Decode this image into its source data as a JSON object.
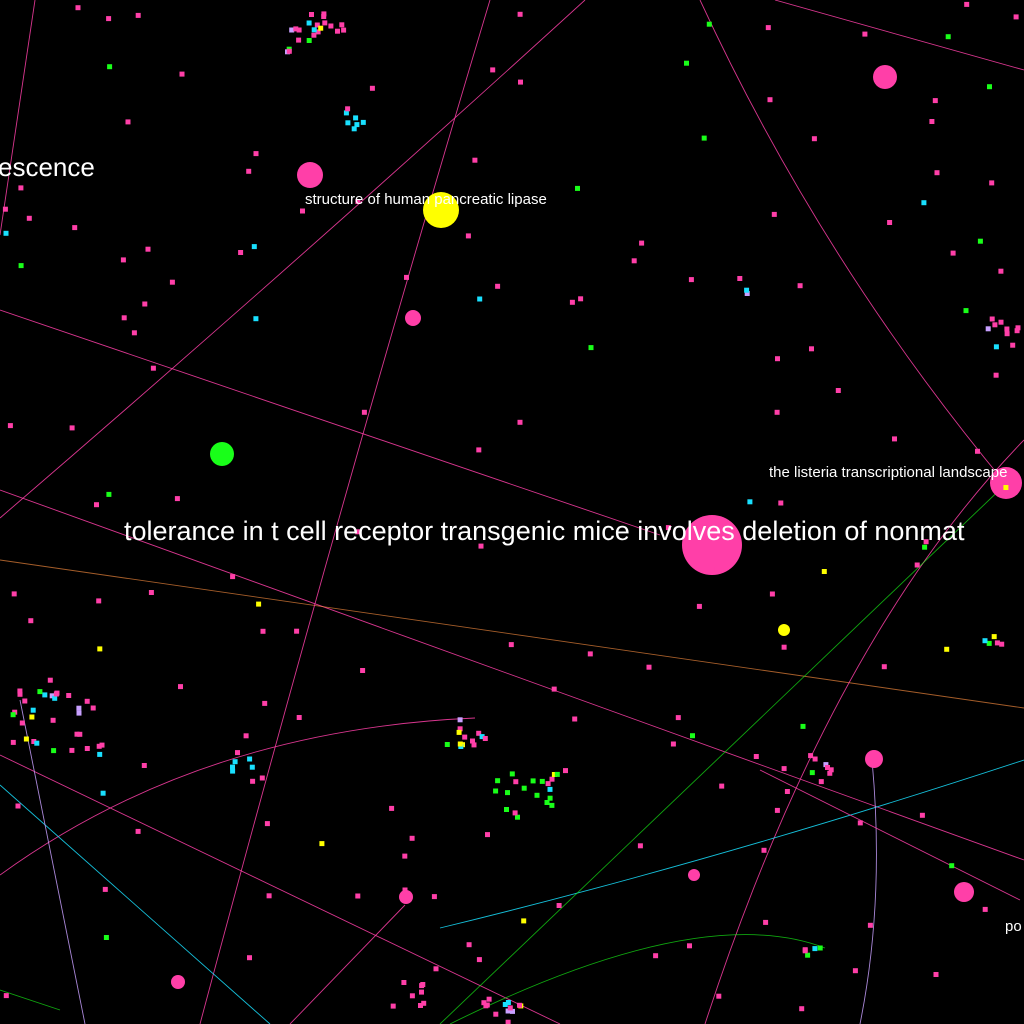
{
  "colors": {
    "background": "#000000",
    "pink": "#ff3fa8",
    "yellow": "#ffff00",
    "green": "#19ff19",
    "cyan": "#19e0ff",
    "lavender": "#c8a0ff",
    "orange": "#ff9040",
    "white": "#ffffff"
  },
  "labels": {
    "tolerance": "tolerance in t cell receptor transgenic mice involves deletion of nonmat",
    "escence": "escence",
    "lipase": "structure of human pancreatic lipase",
    "listeria": "the listeria transcriptional landscape",
    "po": "po"
  },
  "nodes": {
    "tolerance_node": "pink",
    "lipase_node": "yellow",
    "listeria_node": "pink",
    "green_node": "green"
  }
}
